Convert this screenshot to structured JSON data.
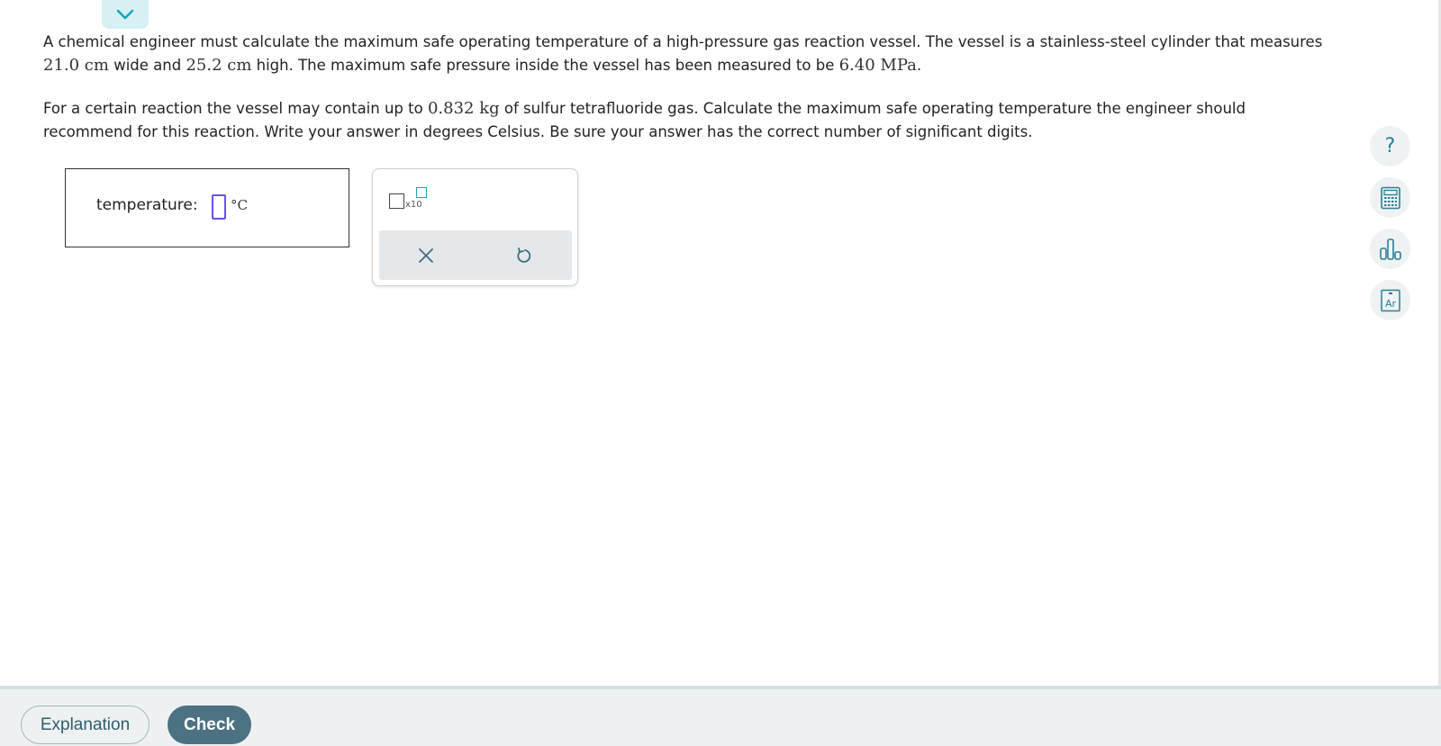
{
  "problem": {
    "p1": {
      "t1": "A chemical engineer must calculate the maximum safe operating temperature of a high-pressure gas reaction vessel. The vessel is a stainless-steel cylinder that measures ",
      "width": "21.0 cm",
      "t2": " wide and ",
      "height": "25.2 cm",
      "t3": " high. The maximum safe pressure inside the vessel has been measured to be ",
      "pressure": "6.40 MPa",
      "t4": "."
    },
    "p2": {
      "t1": "For a certain reaction the vessel may contain up to ",
      "mass": "0.832 kg",
      "t2": " of sulfur tetrafluoride gas. Calculate the maximum safe operating temperature the engineer should recommend for this reaction. Write your answer in degrees Celsius. Be sure your answer has the correct number of significant digits."
    }
  },
  "answer": {
    "label": "temperature:",
    "value": "",
    "unit": "°C"
  },
  "keypad": {
    "sci_notation_label": "x10"
  },
  "footer": {
    "explanation_label": "Explanation",
    "check_label": "Check"
  },
  "side_tools": {
    "help_glyph": "?",
    "periodic_label": "Ar"
  },
  "colors": {
    "accent_teal": "#1aa3b5",
    "input_border": "#6d4ff0",
    "check_bg": "#4b7182"
  }
}
